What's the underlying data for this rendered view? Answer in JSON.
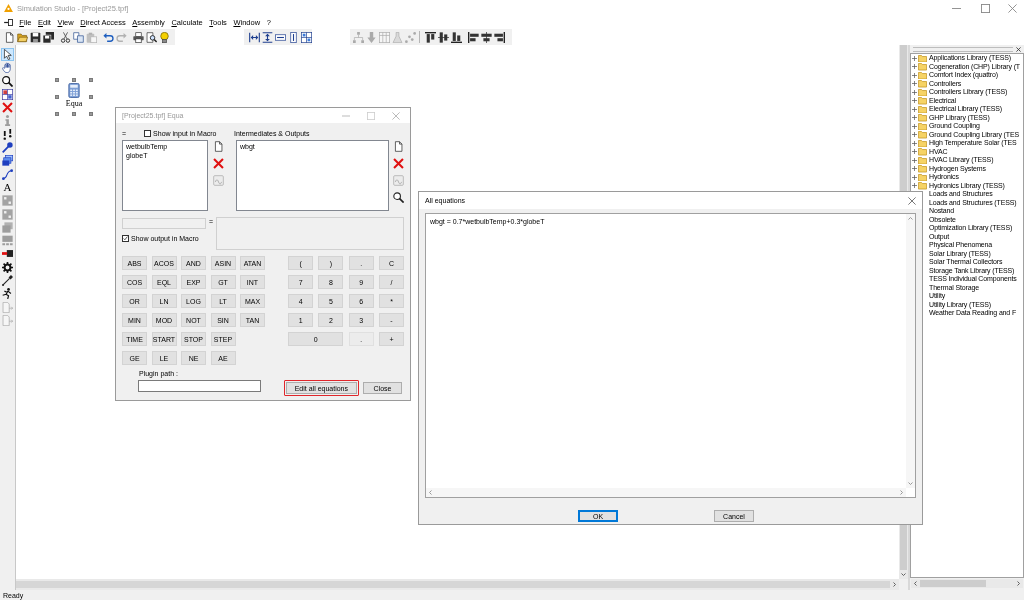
{
  "window": {
    "title": "Simulation Studio - [Project25.tpf]",
    "active": false
  },
  "menu": [
    "File",
    "Edit",
    "View",
    "Direct Access",
    "Assembly",
    "Calculate",
    "Tools",
    "Window",
    "?"
  ],
  "toolbars": [
    [
      {
        "disabled": false
      },
      {
        "disabled": false
      },
      {
        "disabled": false
      },
      {
        "disabled": false
      },
      {
        "disabled": false
      },
      {
        "disabled": false
      },
      {
        "disabled": true
      },
      {
        "disabled": false
      },
      {
        "disabled": true
      },
      {
        "disabled": false
      },
      {
        "disabled": false
      },
      {
        "disabled": false
      }
    ],
    [
      {
        "disabled": false
      },
      {
        "disabled": false
      },
      {
        "disabled": false
      },
      {
        "disabled": false
      },
      {
        "disabled": false
      }
    ],
    [
      {
        "disabled": true
      },
      {
        "disabled": true
      },
      {
        "disabled": true
      },
      {
        "disabled": true
      },
      {
        "disabled": true
      },
      {
        "disabled": false
      },
      {
        "disabled": false
      },
      {
        "disabled": false
      },
      {
        "disabled": false
      },
      {
        "disabled": false
      },
      {
        "disabled": false
      }
    ]
  ],
  "tools": [
    {
      "selected": true,
      "disabled": false
    },
    {
      "selected": false,
      "disabled": false
    },
    {
      "selected": false,
      "disabled": false
    },
    {
      "selected": false,
      "disabled": false
    },
    {
      "selected": false,
      "disabled": false
    },
    {
      "selected": false,
      "disabled": true
    },
    {
      "selected": false,
      "disabled": false
    },
    {
      "selected": false,
      "disabled": false
    },
    {
      "selected": false,
      "disabled": false
    },
    {
      "selected": false,
      "disabled": false
    },
    {
      "glyph": "A",
      "selected": false,
      "disabled": false
    },
    {
      "selected": false,
      "disabled": true
    },
    {
      "selected": false,
      "disabled": true
    },
    {
      "selected": false,
      "disabled": true
    },
    {
      "selected": false,
      "disabled": true
    },
    {
      "selected": false,
      "disabled": false
    },
    {
      "selected": false,
      "disabled": false
    },
    {
      "selected": false,
      "disabled": false
    },
    {
      "selected": false,
      "disabled": false
    },
    {
      "selected": false,
      "disabled": true
    },
    {
      "selected": false,
      "disabled": true
    }
  ],
  "canvas": {
    "components": [
      {
        "label": "Equa",
        "selected": true
      }
    ]
  },
  "library": {
    "items": [
      {
        "label": "Applications Library (TESS)",
        "expanded": false
      },
      {
        "label": "Cogeneration (CHP) Library (T",
        "expanded": false
      },
      {
        "label": "Comfort Index (quattro)",
        "expanded": false
      },
      {
        "label": "Controllers",
        "expanded": false
      },
      {
        "label": "Controllers Library (TESS)",
        "expanded": false
      },
      {
        "label": "Electrical",
        "expanded": false
      },
      {
        "label": "Electrical Library (TESS)",
        "expanded": false
      },
      {
        "label": "GHP Library (TESS)",
        "expanded": false
      },
      {
        "label": "Ground Coupling",
        "expanded": false
      },
      {
        "label": "Ground Coupling Library (TES",
        "expanded": false
      },
      {
        "label": "High Temperature Solar (TES",
        "expanded": false
      },
      {
        "label": "HVAC",
        "expanded": false
      },
      {
        "label": "HVAC Library (TESS)",
        "expanded": false
      },
      {
        "label": "Hydrogen Systems",
        "expanded": false
      },
      {
        "label": "Hydronics",
        "expanded": false
      },
      {
        "label": "Hydronics Library (TESS)",
        "expanded": false
      },
      {
        "label": "Loads and Structures"
      },
      {
        "label": "Loads and Structures (TESS)"
      },
      {
        "label": "Nostand"
      },
      {
        "label": "Obsolete"
      },
      {
        "label": "Optimization Library (TESS)"
      },
      {
        "label": "Output"
      },
      {
        "label": "Physical Phenomena"
      },
      {
        "label": "Solar Library (TESS)"
      },
      {
        "label": "Solar Thermal Collectors"
      },
      {
        "label": "Storage Tank Library (TESS)"
      },
      {
        "label": "TESS Individual Components"
      },
      {
        "label": "Thermal Storage"
      },
      {
        "label": "Utility"
      },
      {
        "label": "Utility Library (TESS)"
      },
      {
        "label": "Weather Data Reading and F"
      }
    ]
  },
  "equation_dialog": {
    "title": "[Project25.tpf] Equa",
    "active": false,
    "inputs_label": "=",
    "show_input_in_macro": {
      "label": "Show input in Macro",
      "checked": false
    },
    "outputs_label": "Intermediates & Outputs",
    "inputs": [
      "wetbulbTemp",
      "globeT"
    ],
    "input_tools": [
      {
        "disabled": false
      },
      {
        "disabled": false
      },
      {
        "disabled": true
      }
    ],
    "outputs": [
      "wbgt"
    ],
    "output_tools": [
      {
        "disabled": false
      },
      {
        "disabled": false
      },
      {
        "disabled": true
      },
      {
        "disabled": false
      }
    ],
    "name_field": {
      "disabled": true
    },
    "equals": "=",
    "formula_field": {
      "disabled": true
    },
    "show_output_in_macro": {
      "label": "Show output in Macro",
      "checked": true
    },
    "functions": [
      [
        "ABS",
        "ACOS",
        "AND",
        "ASIN",
        "ATAN"
      ],
      [
        "COS",
        "EQL",
        "EXP",
        "GT",
        "INT"
      ],
      [
        "OR",
        "LN",
        "LOG",
        "LT",
        "MAX"
      ],
      [
        "MIN",
        "MOD",
        "NOT",
        "SIN",
        "TAN"
      ],
      [
        "TIME",
        "START",
        "STOP",
        "STEP"
      ],
      [
        "GE",
        "LE",
        "NE",
        "AE"
      ]
    ],
    "keypad": [
      {
        "label": "(",
        "kind": "key",
        "disabled": false
      },
      {
        "label": ")",
        "kind": "key",
        "disabled": false
      },
      {
        "label": ".",
        "kind": "key",
        "disabled": false
      },
      {
        "label": "C",
        "kind": "key",
        "disabled": false
      },
      {
        "label": "7",
        "kind": "key",
        "disabled": false
      },
      {
        "label": "8",
        "kind": "key",
        "disabled": false
      },
      {
        "label": "9",
        "kind": "key",
        "disabled": false
      },
      {
        "label": "/",
        "kind": "key",
        "disabled": false
      },
      {
        "label": "4",
        "kind": "key",
        "disabled": false
      },
      {
        "label": "5",
        "kind": "key",
        "disabled": false
      },
      {
        "label": "6",
        "kind": "key",
        "disabled": false
      },
      {
        "label": "*",
        "kind": "key",
        "disabled": false
      },
      {
        "label": "1",
        "kind": "key",
        "disabled": false
      },
      {
        "label": "2",
        "kind": "key",
        "disabled": false
      },
      {
        "label": "3",
        "kind": "key",
        "disabled": false
      },
      {
        "label": "-",
        "kind": "key",
        "disabled": false
      },
      {
        "label": "0",
        "kind": "wide",
        "disabled": false
      },
      {
        "label": ".",
        "kind": "key",
        "disabled": true
      },
      {
        "label": "+",
        "kind": "key",
        "disabled": false
      }
    ],
    "plugin_path": {
      "label": "Plugin path :"
    },
    "buttons": [
      {
        "label": "Edit all equations",
        "highlighted": true
      },
      {
        "label": "Close",
        "highlighted": false
      }
    ]
  },
  "all_equations_dialog": {
    "title": "All equations",
    "active": true,
    "text": "wbgt = 0.7*wetbulbTemp+0.3*globeT",
    "buttons": [
      {
        "label": "OK",
        "focused": true
      },
      {
        "label": "Cancel",
        "focused": false
      }
    ]
  },
  "status_bar": {
    "text": "Ready"
  }
}
